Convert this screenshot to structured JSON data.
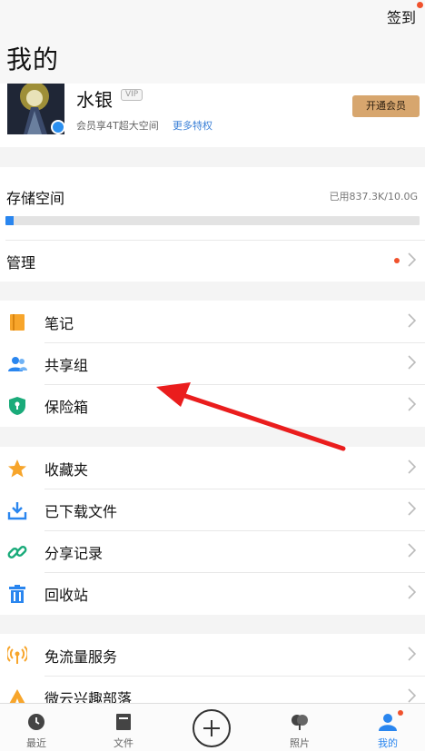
{
  "header": {
    "signin": "签到",
    "title": "我的"
  },
  "profile": {
    "username": "水银",
    "vip_tag": "VIP",
    "vip_sub": "会员享4T超大空间",
    "more_privileges": "更多特权",
    "open_vip": "开通会员"
  },
  "storage": {
    "title": "存储空间",
    "used_text": "已用837.3K/10.0G",
    "fill_fraction": 0.02,
    "accent": "#2a86ef"
  },
  "manage": {
    "label": "管理"
  },
  "group1": [
    {
      "label": "笔记",
      "icon": "notebook-icon"
    },
    {
      "label": "共享组",
      "icon": "group-icon"
    },
    {
      "label": "保险箱",
      "icon": "shield-icon"
    }
  ],
  "group2": [
    {
      "label": "收藏夹",
      "icon": "star-icon"
    },
    {
      "label": "已下载文件",
      "icon": "download-icon"
    },
    {
      "label": "分享记录",
      "icon": "link-icon"
    },
    {
      "label": "回收站",
      "icon": "trash-icon"
    }
  ],
  "group3": [
    {
      "label": "免流量服务",
      "icon": "signal-icon"
    },
    {
      "label": "微云兴趣部落",
      "icon": "tribe-icon"
    }
  ],
  "tabs": [
    {
      "label": "最近",
      "icon": "clock-icon"
    },
    {
      "label": "文件",
      "icon": "file-icon"
    },
    {
      "label": "",
      "icon": "plus-icon"
    },
    {
      "label": "照片",
      "icon": "photo-icon"
    },
    {
      "label": "我的",
      "icon": "person-icon"
    }
  ]
}
